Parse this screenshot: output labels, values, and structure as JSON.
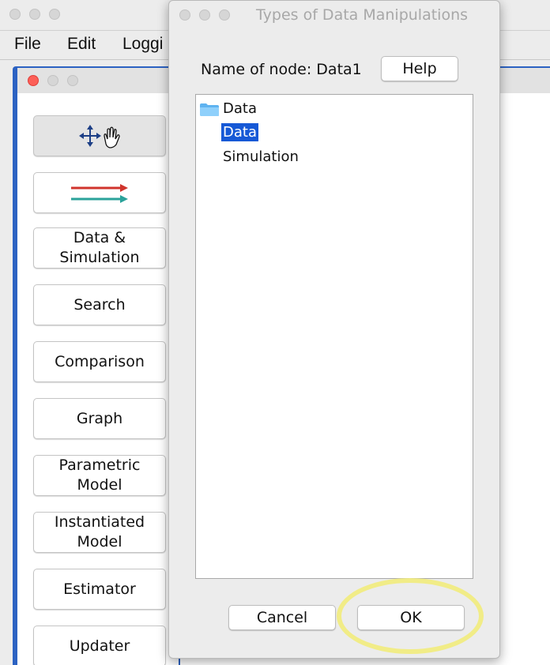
{
  "menubar": {
    "items": [
      "File",
      "Edit",
      "Loggi"
    ]
  },
  "toolbar": {
    "move_tool_icon": "move-hand-icon",
    "edge_tool_icon": "directed-edges-icon",
    "buttons": [
      {
        "label_lines": [
          "Data &",
          "Simulation"
        ]
      },
      {
        "label_lines": [
          "Search"
        ]
      },
      {
        "label_lines": [
          "Comparison"
        ]
      },
      {
        "label_lines": [
          "Graph"
        ]
      },
      {
        "label_lines": [
          "Parametric",
          "Model"
        ]
      },
      {
        "label_lines": [
          "Instantiated",
          "Model"
        ]
      },
      {
        "label_lines": [
          "Estimator"
        ]
      },
      {
        "label_lines": [
          "Updater"
        ]
      }
    ]
  },
  "dialog": {
    "title": "Types of Data Manipulations",
    "node_label": "Name of node: Data1",
    "help_label": "Help",
    "tree": {
      "root": "Data",
      "children": [
        "Data",
        "Simulation"
      ],
      "selected": "Data"
    },
    "cancel_label": "Cancel",
    "ok_label": "OK"
  },
  "colors": {
    "selection": "#1659d6",
    "inner_frame": "#2c62c2",
    "highlight": "#f2ec7c",
    "arrow_red": "#d0342c",
    "arrow_teal": "#2aa29a"
  }
}
